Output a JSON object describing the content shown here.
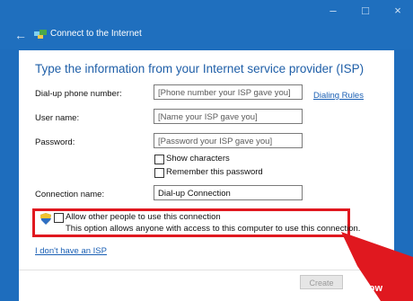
{
  "window": {
    "title": "Connect to the Internet",
    "controls": [
      "–",
      "□",
      "×"
    ]
  },
  "heading": "Type the information from your Internet service provider (ISP)",
  "fields": {
    "phone": {
      "label": "Dial-up phone number:",
      "value": "[Phone number your ISP gave you]"
    },
    "user": {
      "label": "User name:",
      "value": "[Name your ISP gave you]"
    },
    "password": {
      "label": "Password:",
      "value": "[Password your ISP gave you]"
    },
    "connection": {
      "label": "Connection name:",
      "value": "Dial-up Connection"
    }
  },
  "dialing_rules": "Dialing Rules",
  "show_characters": "Show characters",
  "remember_password": "Remember this password",
  "allow_others": {
    "label": "Allow other people to use this connection",
    "note": "This option allows anyone with access to this computer to use this connection."
  },
  "no_isp_link": "I don't have an ISP",
  "create_button": "Create",
  "watermark": "wikiHow",
  "colors": {
    "accent": "#1f6fbe",
    "highlight": "#e0181f",
    "link": "#1a5fb4"
  }
}
